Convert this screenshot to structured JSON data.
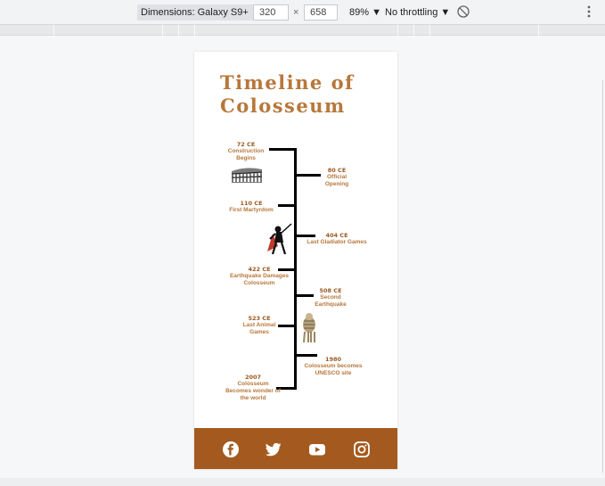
{
  "devtools": {
    "device_label": "Dimensions: Galaxy S9+ ▼",
    "width_value": "320",
    "times": "×",
    "height_value": "658",
    "zoom": "89% ▼",
    "throttling": "No throttling ▼"
  },
  "page": {
    "title": "Timeline of Colosseum",
    "events": [
      {
        "year": "72 CE",
        "text": "Construction Begins"
      },
      {
        "year": "80 CE",
        "text": "Official Opening"
      },
      {
        "year": "110 CE",
        "text": "First Martyrdom"
      },
      {
        "year": "404 CE",
        "text": "Last Gladiator Games"
      },
      {
        "year": "422 CE",
        "text": "Earthquake Damages Colosseum"
      },
      {
        "year": "508 CE",
        "text": "Second Earthquake"
      },
      {
        "year": "523 CE",
        "text": "Last Animal Games"
      },
      {
        "year": "1980",
        "text": "Colosseum  becomes UNESCO site"
      },
      {
        "year": "2007",
        "text": "Colosseum Becomes wonder of the world"
      }
    ],
    "social_icons": [
      "facebook-icon",
      "twitter-icon",
      "youtube-icon",
      "instagram-icon"
    ],
    "colors": {
      "accent": "#b7773b",
      "footer": "#a45a1e"
    }
  }
}
